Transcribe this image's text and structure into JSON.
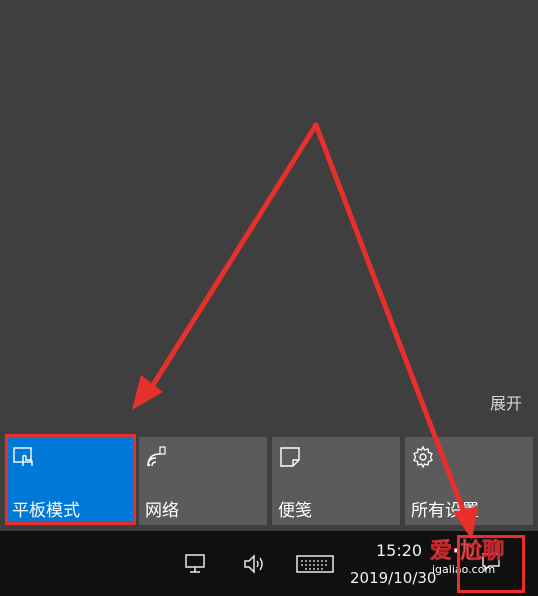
{
  "action_center": {
    "expand_label": "展开",
    "tiles": [
      {
        "label": "平板模式",
        "icon": "tablet-mode-icon",
        "active": true
      },
      {
        "label": "网络",
        "icon": "network-icon",
        "active": false
      },
      {
        "label": "便笺",
        "icon": "note-icon",
        "active": false
      },
      {
        "label": "所有设置",
        "icon": "settings-gear-icon",
        "active": false
      }
    ]
  },
  "taskbar": {
    "time": "15:20",
    "date": "2019/10/30",
    "icons": [
      "network-monitor-icon",
      "volume-icon",
      "keyboard-icon",
      "notification-icon"
    ]
  },
  "watermark": {
    "text": "爱·尬聊",
    "url": "igaliao.com"
  },
  "colors": {
    "active_tile": "#0078d7",
    "tile": "#5b5b5b",
    "annotation_red": "#e7302b"
  }
}
